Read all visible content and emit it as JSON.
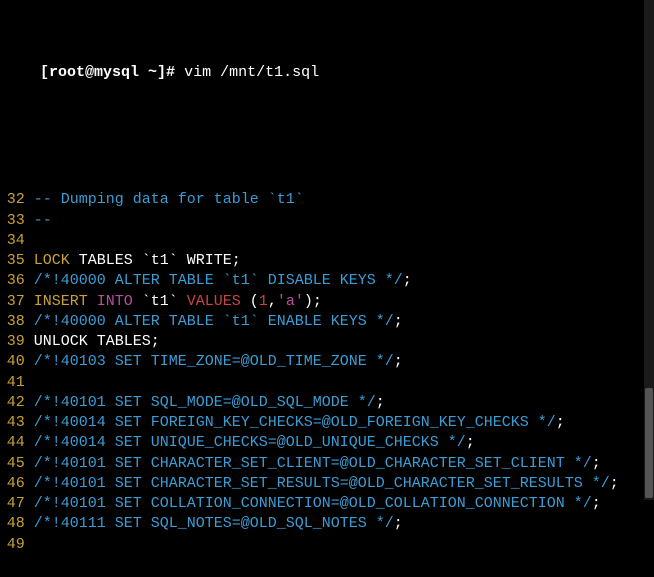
{
  "prompt": {
    "user_host": "[root@mysql ~]#",
    "command": "vim /mnt/t1.sql"
  },
  "lines": [
    {
      "n": 32,
      "tokens": [
        {
          "cls": "c-comment",
          "t": "-- Dumping data for table `t1`"
        }
      ]
    },
    {
      "n": 33,
      "tokens": [
        {
          "cls": "c-comment",
          "t": "--"
        }
      ]
    },
    {
      "n": 34,
      "tokens": []
    },
    {
      "n": 35,
      "tokens": [
        {
          "cls": "c-keyword-lock",
          "t": "LOCK"
        },
        {
          "cls": "c-white",
          "t": " TABLES `t1` WRITE;"
        }
      ]
    },
    {
      "n": 36,
      "tokens": [
        {
          "cls": "c-comment",
          "t": "/*!40000 ALTER TABLE `t1` DISABLE KEYS */"
        },
        {
          "cls": "c-white",
          "t": ";"
        }
      ]
    },
    {
      "n": 37,
      "tokens": [
        {
          "cls": "c-keyword-insert",
          "t": "INSERT"
        },
        {
          "cls": "c-white",
          "t": " "
        },
        {
          "cls": "c-keyword-into",
          "t": "INTO"
        },
        {
          "cls": "c-white",
          "t": " `t1` "
        },
        {
          "cls": "c-values",
          "t": "VALUES"
        },
        {
          "cls": "c-white",
          "t": " ("
        },
        {
          "cls": "c-num",
          "t": "1"
        },
        {
          "cls": "c-white",
          "t": ","
        },
        {
          "cls": "c-str",
          "t": "'a'"
        },
        {
          "cls": "c-white",
          "t": ");"
        }
      ]
    },
    {
      "n": 38,
      "tokens": [
        {
          "cls": "c-comment",
          "t": "/*!40000 ALTER TABLE `t1` ENABLE KEYS */"
        },
        {
          "cls": "c-white",
          "t": ";"
        }
      ]
    },
    {
      "n": 39,
      "tokens": [
        {
          "cls": "c-white",
          "t": "UNLOCK TABLES;"
        }
      ]
    },
    {
      "n": 40,
      "tokens": [
        {
          "cls": "c-comment",
          "t": "/*!40103 SET TIME_ZONE=@OLD_TIME_ZONE */"
        },
        {
          "cls": "c-white",
          "t": ";"
        }
      ]
    },
    {
      "n": 41,
      "tokens": []
    },
    {
      "n": 42,
      "tokens": [
        {
          "cls": "c-comment",
          "t": "/*!40101 SET SQL_MODE=@OLD_SQL_MODE */"
        },
        {
          "cls": "c-white",
          "t": ";"
        }
      ]
    },
    {
      "n": 43,
      "tokens": [
        {
          "cls": "c-comment",
          "t": "/*!40014 SET FOREIGN_KEY_CHECKS=@OLD_FOREIGN_KEY_CHECKS */"
        },
        {
          "cls": "c-white",
          "t": ";"
        }
      ]
    },
    {
      "n": 44,
      "tokens": [
        {
          "cls": "c-comment",
          "t": "/*!40014 SET UNIQUE_CHECKS=@OLD_UNIQUE_CHECKS */"
        },
        {
          "cls": "c-white",
          "t": ";"
        }
      ]
    },
    {
      "n": 45,
      "tokens": [
        {
          "cls": "c-comment",
          "t": "/*!40101 SET CHARACTER_SET_CLIENT=@OLD_CHARACTER_SET_CLIENT */"
        },
        {
          "cls": "c-white",
          "t": ";"
        }
      ]
    },
    {
      "n": 46,
      "tokens": [
        {
          "cls": "c-comment",
          "t": "/*!40101 SET CHARACTER_SET_RESULTS=@OLD_CHARACTER_SET_RESULTS */"
        },
        {
          "cls": "c-white",
          "t": ";"
        }
      ]
    },
    {
      "n": 47,
      "tokens": [
        {
          "cls": "c-comment",
          "t": "/*!40101 SET COLLATION_CONNECTION=@OLD_COLLATION_CONNECTION */"
        },
        {
          "cls": "c-white",
          "t": ";"
        }
      ]
    },
    {
      "n": 48,
      "tokens": [
        {
          "cls": "c-comment",
          "t": "/*!40111 SET SQL_NOTES=@OLD_SQL_NOTES */"
        },
        {
          "cls": "c-white",
          "t": ";"
        }
      ]
    },
    {
      "n": 49,
      "tokens": []
    }
  ]
}
